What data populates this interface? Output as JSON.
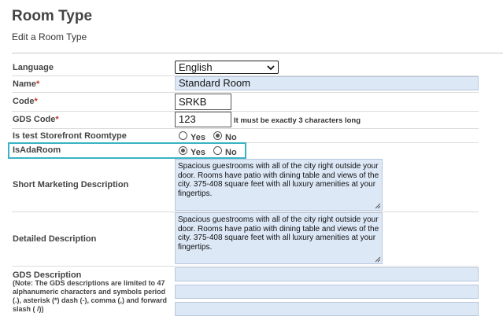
{
  "header": {
    "title": "Room Type",
    "subtitle": "Edit a Room Type"
  },
  "form": {
    "language": {
      "label": "Language",
      "value": "English"
    },
    "name": {
      "label": "Name",
      "required_mark": "*",
      "value": "Standard Room"
    },
    "code": {
      "label": "Code",
      "required_mark": "*",
      "value": "SRKB"
    },
    "gds_code": {
      "label": "GDS Code",
      "required_mark": "*",
      "value": "123",
      "hint": "It must be exactly 3 characters long"
    },
    "is_test": {
      "label": "Is test Storefront Roomtype",
      "yes": "Yes",
      "no": "No",
      "selected": "No"
    },
    "is_ada": {
      "label": "IsAdaRoom",
      "yes": "Yes",
      "no": "No",
      "selected": "Yes"
    },
    "short_desc": {
      "label": "Short Marketing Description",
      "value": "Spacious guestrooms with all of the city right outside your door. Rooms have patio with dining table and views of the city. 375-408 square feet with all luxury amenities at your fingertips."
    },
    "detailed_desc": {
      "label": "Detailed Description",
      "value": "Spacious guestrooms with all of the city right outside your door. Rooms have patio with dining table and views of the city. 375-408 square feet with all luxury amenities at your fingertips."
    },
    "gds_desc": {
      "label": "GDS Description",
      "note": "(Note: The GDS descriptions are limited to 47 alphanumeric characters and symbols period (.), asterisk (*) dash (-), comma (,) and forward slash ( /))",
      "values": [
        "",
        "",
        ""
      ]
    }
  },
  "colors": {
    "highlight": "#3ab3c4",
    "input_blue": "#dde8f7",
    "required": "#c0392b"
  }
}
